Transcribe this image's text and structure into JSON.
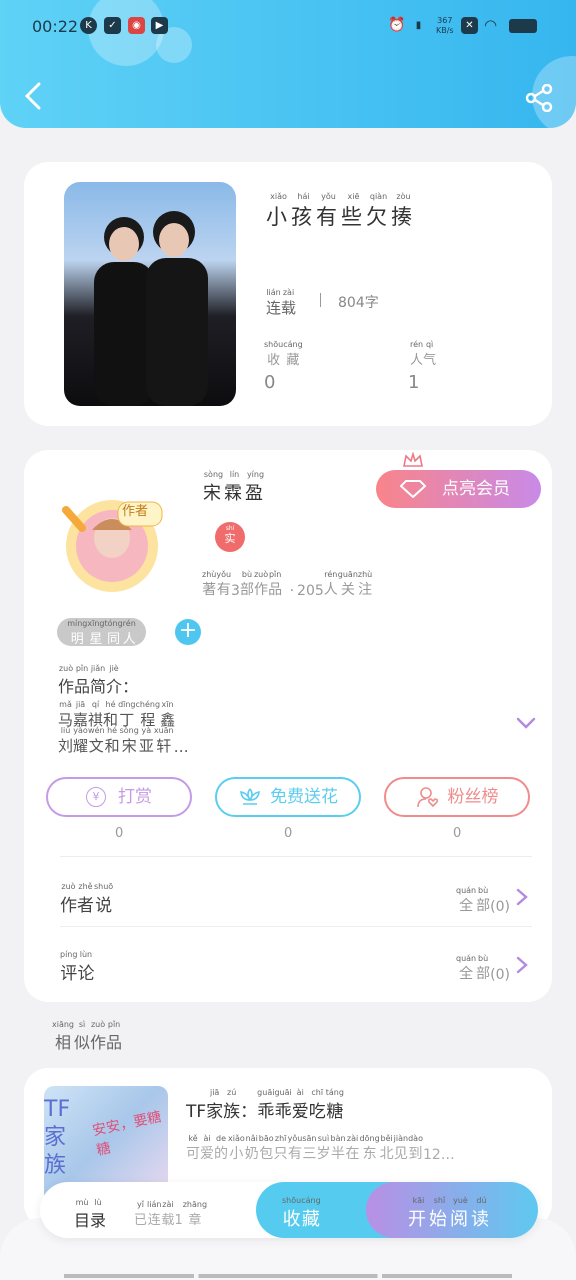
{
  "status_bar": {
    "time": "00:22",
    "net_speed_value": "367",
    "net_speed_unit": "KB/s"
  },
  "book": {
    "title": [
      [
        "小",
        "xiǎo"
      ],
      [
        "孩",
        "hái"
      ],
      [
        "有",
        "yǒu"
      ],
      [
        "些",
        "xiē"
      ],
      [
        "欠",
        "qiàn"
      ],
      [
        "揍",
        "zòu"
      ]
    ],
    "status": [
      [
        "连",
        "lián"
      ],
      [
        "载",
        "zài"
      ]
    ],
    "word_count": "804字",
    "collect_label": [
      [
        "收",
        "shōu"
      ],
      [
        "藏",
        "cáng"
      ]
    ],
    "collect_value": "0",
    "popularity_label": [
      [
        "人",
        "rén"
      ],
      [
        "气",
        "qì"
      ]
    ],
    "popularity_value": "1"
  },
  "author": {
    "name": [
      [
        "宋",
        "sòng"
      ],
      [
        "霖",
        "lín"
      ],
      [
        "盈",
        "yíng"
      ]
    ],
    "avatar_badge": "作者",
    "verified": {
      "py": "shí",
      "ch": "实"
    },
    "stats_a": [
      [
        "著",
        "zhù"
      ],
      [
        "有",
        "yǒu"
      ]
    ],
    "stats_num": "3",
    "stats_b": [
      [
        "部",
        "bù"
      ],
      [
        "作",
        "zuò"
      ],
      [
        "品",
        "pǐn"
      ]
    ],
    "stats_sep": "·",
    "stats_c": "205",
    "stats_d": [
      [
        "人",
        "rén"
      ],
      [
        "关",
        "guān"
      ],
      [
        "注",
        "zhù"
      ]
    ],
    "vip_button": "点亮会员",
    "tag": [
      [
        "明",
        "míng"
      ],
      [
        "星",
        "xīng"
      ],
      [
        "同",
        "tóng"
      ],
      [
        "人",
        "rén"
      ]
    ],
    "add_tag": "+",
    "intro_label": [
      [
        "作",
        "zuò"
      ],
      [
        "品",
        "pǐn"
      ],
      [
        "简",
        "jiǎn"
      ],
      [
        "介",
        "jiè"
      ]
    ],
    "intro_colon": "：",
    "intro_line1": [
      [
        "马",
        "mǎ"
      ],
      [
        "嘉",
        "jiā"
      ],
      [
        "祺",
        "qí"
      ],
      [
        "和",
        "hé"
      ],
      [
        "丁",
        "dīng"
      ],
      [
        "程",
        "chéng"
      ],
      [
        "鑫",
        "xīn"
      ]
    ],
    "intro_line2": [
      [
        "刘",
        "liú"
      ],
      [
        "耀",
        "yào"
      ],
      [
        "文",
        "wén"
      ],
      [
        "和",
        "hé"
      ],
      [
        "宋",
        "sòng"
      ],
      [
        "亚",
        "yà"
      ],
      [
        "轩",
        "xuān"
      ]
    ],
    "intro_ellipsis": "…"
  },
  "actions": [
    {
      "label": "打赏",
      "count": "0",
      "color": "#c49be6",
      "icon": "yen-coin-icon"
    },
    {
      "label": "免费送花",
      "count": "0",
      "color": "#5ccdf0",
      "icon": "flower-icon"
    },
    {
      "label": "粉丝榜",
      "count": "0",
      "color": "#ef8c8c",
      "icon": "fan-user-icon"
    }
  ],
  "author_says": {
    "label": [
      [
        "作",
        "zuò"
      ],
      [
        "者",
        "zhě"
      ],
      [
        "说",
        "shuō"
      ]
    ],
    "all": [
      [
        "全",
        "quán"
      ],
      [
        "部",
        "bù"
      ]
    ],
    "count": "(0)"
  },
  "comments": {
    "label": [
      [
        "评",
        "píng"
      ],
      [
        "论",
        "lùn"
      ]
    ],
    "all": [
      [
        "全",
        "quán"
      ],
      [
        "部",
        "bù"
      ]
    ],
    "count": "(0)"
  },
  "similar": {
    "heading": [
      [
        "相",
        "xiāng"
      ],
      [
        "似",
        "sì"
      ],
      [
        "作",
        "zuò"
      ],
      [
        "品",
        "pǐn"
      ]
    ],
    "item_prefix": "TF",
    "item_title_a": [
      [
        "家",
        "jiā"
      ],
      [
        "族",
        "zú"
      ]
    ],
    "item_colon": "：",
    "item_title_b": [
      [
        "乖",
        "guāi"
      ],
      [
        "乖",
        "guāi"
      ],
      [
        "爱",
        "ài"
      ],
      [
        "吃",
        "chī"
      ],
      [
        "糖",
        "táng"
      ]
    ],
    "item_desc": [
      [
        "可",
        "kě"
      ],
      [
        "爱",
        "ài"
      ],
      [
        "的",
        "de"
      ],
      [
        "小",
        "xiǎo"
      ],
      [
        "奶",
        "nǎi"
      ],
      [
        "包",
        "bāo"
      ],
      [
        "只",
        "zhī"
      ],
      [
        "有",
        "yǒu"
      ],
      [
        "三",
        "sān"
      ],
      [
        "岁",
        "suì"
      ],
      [
        "半",
        "bàn"
      ],
      [
        "在",
        "zài"
      ],
      [
        "东",
        "dōng"
      ],
      [
        "北",
        "běi"
      ],
      [
        "见",
        "jiàn"
      ],
      [
        "到",
        "dào"
      ]
    ],
    "item_desc_tail": "12…",
    "cover_text_left": "TF家族",
    "cover_text_right": "安安，要糖糖"
  },
  "bottom_bar": {
    "catalog": [
      [
        "目",
        "mù"
      ],
      [
        "录",
        "lù"
      ]
    ],
    "progress_a": [
      [
        "已",
        "yǐ"
      ],
      [
        "连",
        "lián"
      ],
      [
        "载",
        "zài"
      ]
    ],
    "progress_num": "1",
    "progress_b": [
      [
        "章",
        "zhāng"
      ]
    ],
    "collect": [
      [
        "收",
        "shōu"
      ],
      [
        "藏",
        "cáng"
      ]
    ],
    "read": [
      [
        "开",
        "kāi"
      ],
      [
        "始",
        "shǐ"
      ],
      [
        "阅",
        "yuè"
      ],
      [
        "读",
        "dú"
      ]
    ]
  }
}
